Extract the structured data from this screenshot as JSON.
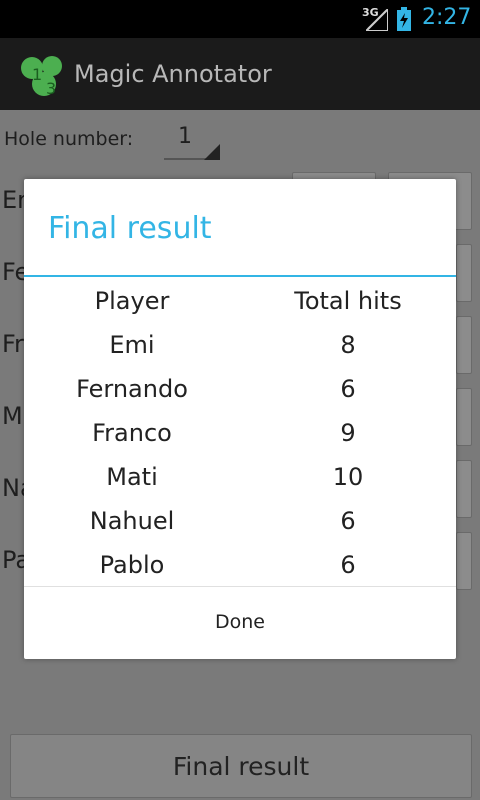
{
  "status": {
    "network": "3G",
    "time": "2:27"
  },
  "app": {
    "title": "Magic Annotator"
  },
  "form": {
    "hole_label": "Hole number:",
    "hole_value": "1",
    "players_visible": [
      "Em",
      "Fe",
      "Fr",
      "M",
      "Na",
      "Pa"
    ]
  },
  "final_button": "Final result",
  "dialog": {
    "title": "Final result",
    "headers": {
      "player": "Player",
      "hits": "Total hits"
    },
    "rows": [
      {
        "player": "Emi",
        "hits": "8"
      },
      {
        "player": "Fernando",
        "hits": "6"
      },
      {
        "player": "Franco",
        "hits": "9"
      },
      {
        "player": "Mati",
        "hits": "10"
      },
      {
        "player": "Nahuel",
        "hits": "6"
      },
      {
        "player": "Pablo",
        "hits": "6"
      }
    ],
    "done_label": "Done"
  },
  "colors": {
    "accent": "#33b5e5",
    "logo": "#4caf50"
  }
}
